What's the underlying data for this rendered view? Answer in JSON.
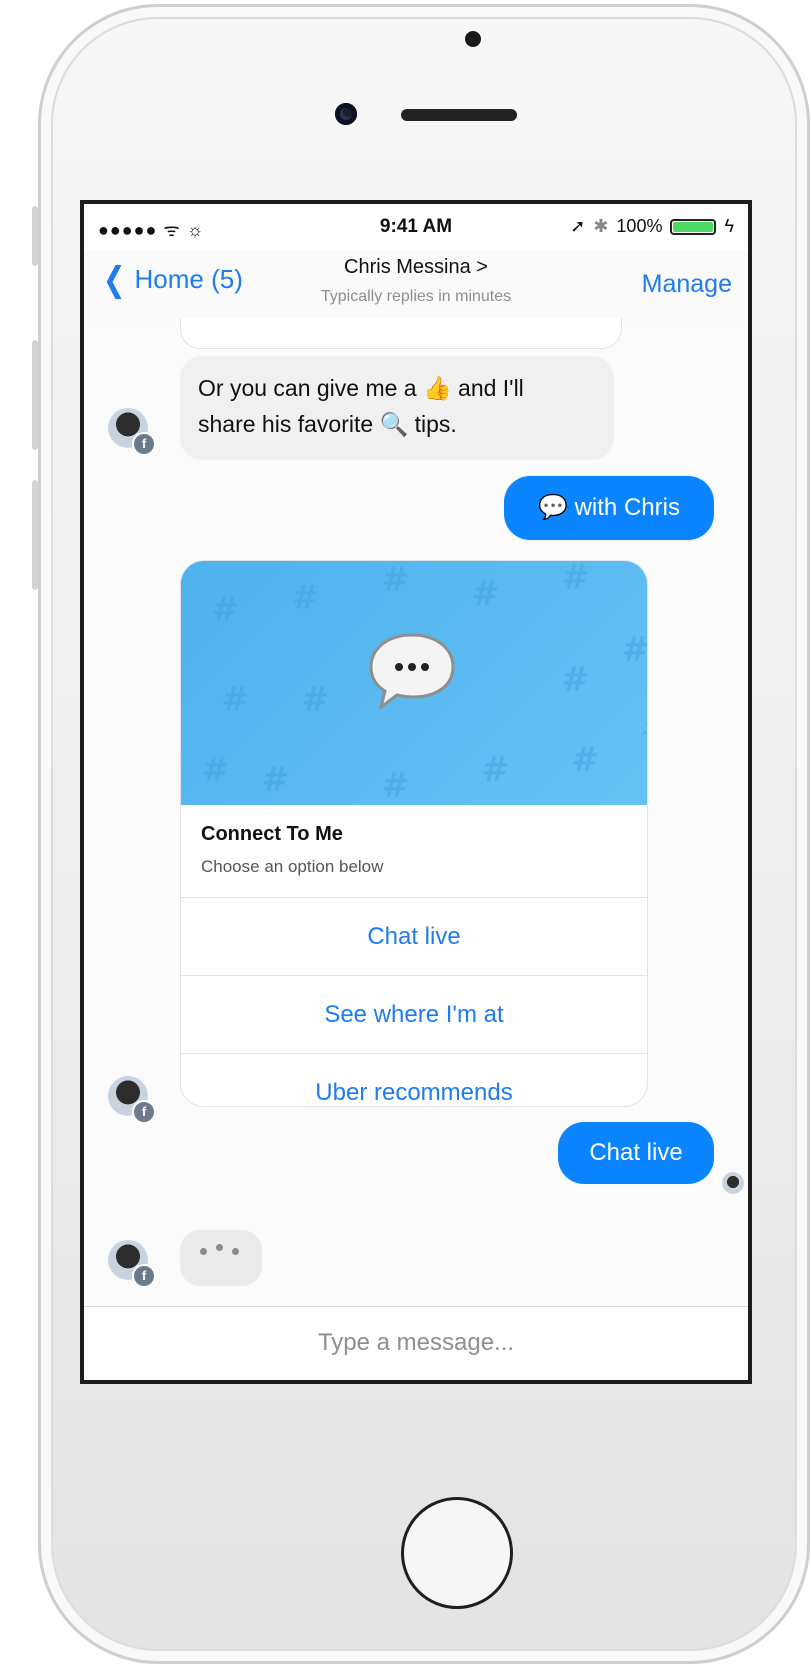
{
  "status_bar": {
    "signal": "●●●●● ᯤ ☼",
    "time": "9:41 AM",
    "location_arrow": "➚",
    "bluetooth": "✱",
    "battery_percent": "100%",
    "battery_level": 1.0,
    "charging": "ϟ"
  },
  "nav": {
    "back_label": "Home (5)",
    "title": "Chris Messina >",
    "subtitle": "Typically replies in minutes",
    "manage": "Manage"
  },
  "messages": {
    "bot_message_line1_a": "Or you can give me a",
    "bot_message_line1_b": "and I'll",
    "bot_message_line2_a": "share his favorite",
    "bot_message_line2_b": "tips.",
    "thumbs_emoji": "👍",
    "mag_emoji": "🔍",
    "user_reply_1": "with Chris",
    "user_reply_1_icon": "💬",
    "user_reply_2": "Chat live"
  },
  "card": {
    "title": "Connect To Me",
    "subtitle": "Choose an option below",
    "buttons": [
      "Chat live",
      "See where I'm at",
      "Uber recommends"
    ],
    "hero_icon": "speech-bubble-icon",
    "hero_pattern_glyph": "#"
  },
  "composer": {
    "placeholder": "Type a message..."
  },
  "colors": {
    "accent": "#1e7cf0",
    "outgoing_bubble": "#0a84ff",
    "incoming_bubble": "#f1f0f0",
    "card_hero": "#5bbaf0",
    "battery": "#4cd964"
  }
}
